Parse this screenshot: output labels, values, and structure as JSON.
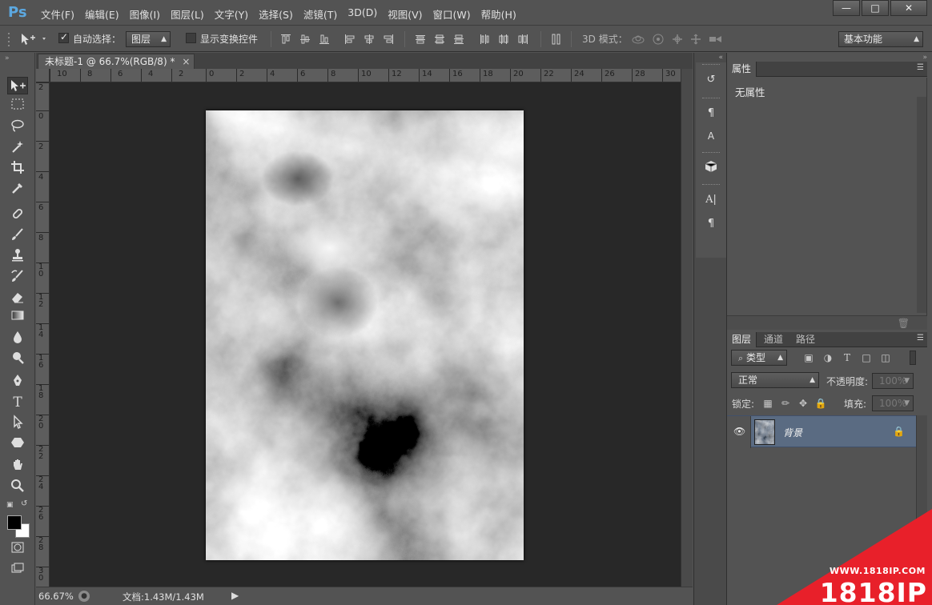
{
  "app": {
    "logo": "Ps"
  },
  "menu": [
    "文件(F)",
    "编辑(E)",
    "图像(I)",
    "图层(L)",
    "文字(Y)",
    "选择(S)",
    "滤镜(T)",
    "3D(D)",
    "视图(V)",
    "窗口(W)",
    "帮助(H)"
  ],
  "window_controls": {
    "minimize": "—",
    "restore": "□",
    "close": "✕"
  },
  "options": {
    "auto_select_label": "自动选择：",
    "auto_select_checked": true,
    "auto_select_target": "图层",
    "show_transform_label": "显示变换控件",
    "show_transform_checked": false,
    "mode_3d_label": "3D 模式：",
    "workspace": "基本功能"
  },
  "document": {
    "tab_title": "未标题-1 @ 66.7%(RGB/8) *",
    "tab_close": "×",
    "zoom": "66.67%",
    "doc_info": "文档:1.43M/1.43M"
  },
  "rulers": {
    "top": [
      "10",
      "8",
      "6",
      "4",
      "2",
      "0",
      "2",
      "4",
      "6",
      "8",
      "10",
      "12",
      "14",
      "16",
      "18",
      "20",
      "22",
      "24",
      "26",
      "28",
      "30"
    ],
    "left": [
      "2",
      "0",
      "2",
      "4",
      "6",
      "8",
      "10",
      "12",
      "14",
      "16",
      "18",
      "20",
      "22",
      "24",
      "26",
      "28",
      "30"
    ]
  },
  "toolbar": {
    "tools": [
      "move-tool",
      "marquee-tool",
      "lasso-tool",
      "magic-wand-tool",
      "crop-tool",
      "eyedropper-tool",
      "healing-brush-tool",
      "brush-tool",
      "clone-stamp-tool",
      "history-brush-tool",
      "eraser-tool",
      "gradient-tool",
      "blur-tool",
      "dodge-tool",
      "pen-tool",
      "type-tool",
      "path-selection-tool",
      "shape-tool",
      "hand-tool",
      "zoom-tool"
    ],
    "foreground_color": "#000000",
    "background_color": "#ffffff"
  },
  "properties_panel": {
    "tab": "属性",
    "body_text": "无属性"
  },
  "layers_panel": {
    "tabs": [
      "图层",
      "通道",
      "路径"
    ],
    "filter_kind": "类型",
    "blend_mode": "正常",
    "opacity_label": "不透明度:",
    "opacity_value": "100%",
    "lock_label": "锁定:",
    "fill_label": "填充:",
    "fill_value": "100%",
    "layers": [
      {
        "name": "背景",
        "visible": true,
        "locked": true,
        "selected": true
      }
    ]
  },
  "watermark": {
    "url": "WWW.1818IP.COM",
    "brand": "1818IP",
    "color": "#e8202a"
  }
}
